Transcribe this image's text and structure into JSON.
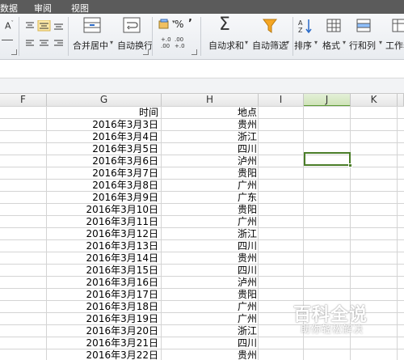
{
  "menu": {
    "items": [
      "数据",
      "审阅",
      "视图"
    ]
  },
  "ribbon": {
    "percent_label": "%",
    "comma_label": "’",
    "dec_increase_label": "+.0 .00",
    "dec_decrease_label": ".00 +.0",
    "merge_center_label": "合并居中",
    "wrap_text_label": "自动换行",
    "autosum_label": "自动求和",
    "filter_label": "自动筛选",
    "sort_label": "排序",
    "format_label": "格式",
    "rowcol_label": "行和列",
    "worksheet_label": "工作表",
    "accent_color": "#4a7d28"
  },
  "columns": [
    {
      "label": "F"
    },
    {
      "label": "G"
    },
    {
      "label": "H"
    },
    {
      "label": "I"
    },
    {
      "label": "J",
      "selected": true
    },
    {
      "label": "K"
    }
  ],
  "table": {
    "header": {
      "time": "时间",
      "place": "地点"
    },
    "rows": [
      {
        "date": "2016年3月3日",
        "place": "贵州"
      },
      {
        "date": "2016年3月4日",
        "place": "浙江"
      },
      {
        "date": "2016年3月5日",
        "place": "四川"
      },
      {
        "date": "2016年3月6日",
        "place": "泸州"
      },
      {
        "date": "2016年3月7日",
        "place": "贵阳"
      },
      {
        "date": "2016年3月8日",
        "place": "广州"
      },
      {
        "date": "2016年3月9日",
        "place": "广东"
      },
      {
        "date": "2016年3月10日",
        "place": "贵阳"
      },
      {
        "date": "2016年3月11日",
        "place": "广州"
      },
      {
        "date": "2016年3月12日",
        "place": "浙江"
      },
      {
        "date": "2016年3月13日",
        "place": "四川"
      },
      {
        "date": "2016年3月14日",
        "place": "贵州"
      },
      {
        "date": "2016年3月15日",
        "place": "四川"
      },
      {
        "date": "2016年3月16日",
        "place": "泸州"
      },
      {
        "date": "2016年3月17日",
        "place": "贵阳"
      },
      {
        "date": "2016年3月18日",
        "place": "广州"
      },
      {
        "date": "2016年3月19日",
        "place": "广州"
      },
      {
        "date": "2016年3月20日",
        "place": "浙江"
      },
      {
        "date": "2016年3月21日",
        "place": "四川"
      },
      {
        "date": "2016年3月22日",
        "place": "贵州"
      }
    ]
  },
  "watermark": {
    "title": "百科全说",
    "subtitle": "助你轻松解决"
  }
}
